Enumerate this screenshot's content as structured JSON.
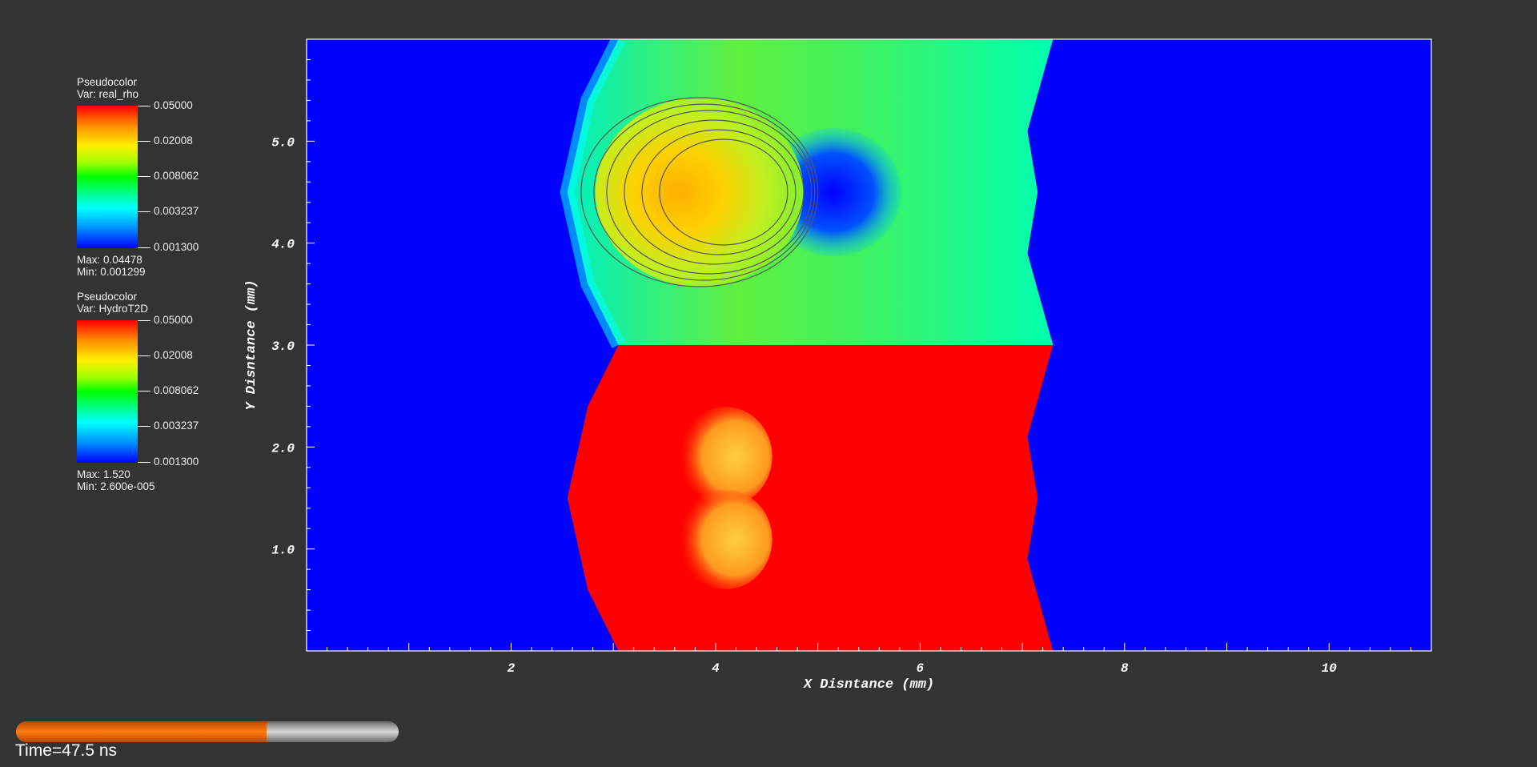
{
  "legends": [
    {
      "plot_type": "Pseudocolor",
      "var_label": "Var: real_rho",
      "ticks": [
        "0.05000",
        "0.02008",
        "0.008062",
        "0.003237",
        "0.001300"
      ],
      "max_label": "Max:  0.04478",
      "min_label": "Min:  0.001299"
    },
    {
      "plot_type": "Pseudocolor",
      "var_label": "Var: HydroT2D",
      "ticks": [
        "0.05000",
        "0.02008",
        "0.008062",
        "0.003237",
        "0.001300"
      ],
      "max_label": "Max:  1.520",
      "min_label": "Min:  2.600e-005"
    }
  ],
  "colors": {
    "background": "#333333",
    "ambient": "#0000ff",
    "shocked_top": "#00f0a0",
    "shocked_bottom": "#ff0000",
    "contour": "#555555",
    "timer_fill": "#ff7a10"
  },
  "time_slider": {
    "progress": 0.655
  },
  "time_label": "Time=47.5 ns",
  "chart_data": {
    "type": "heatmap",
    "xlabel": "X Disntance (mm)",
    "ylabel": "Y Disntance (mm)",
    "xlim": [
      0,
      11.0
    ],
    "ylim": [
      0,
      6.0
    ],
    "x_ticks": [
      2,
      4,
      6,
      8,
      10
    ],
    "x_tick_labels": [
      "2",
      "4",
      "6",
      "8",
      "10"
    ],
    "y_ticks": [
      1.0,
      2.0,
      3.0,
      4.0,
      5.0
    ],
    "y_tick_labels": [
      "1.0",
      "2.0",
      "3.0",
      "4.0",
      "5.0"
    ],
    "split_y": 3.0,
    "left_shock_front": [
      [
        3.05,
        6.0
      ],
      [
        2.75,
        5.4
      ],
      [
        2.55,
        4.5
      ],
      [
        2.75,
        3.6
      ],
      [
        3.05,
        3.0
      ]
    ],
    "right_shock_front": [
      [
        7.3,
        6.0
      ],
      [
        7.05,
        5.1
      ],
      [
        7.15,
        4.5
      ],
      [
        7.05,
        3.9
      ],
      [
        7.3,
        3.0
      ]
    ],
    "clump_center": [
      4.0,
      4.5
    ],
    "series": [
      {
        "name": "real_rho",
        "region": "top",
        "colormap_min": 0.0013,
        "colormap_max": 0.05
      },
      {
        "name": "HydroT2D",
        "region": "bottom",
        "colormap_min": 0.0013,
        "colormap_max": 0.05
      }
    ]
  }
}
